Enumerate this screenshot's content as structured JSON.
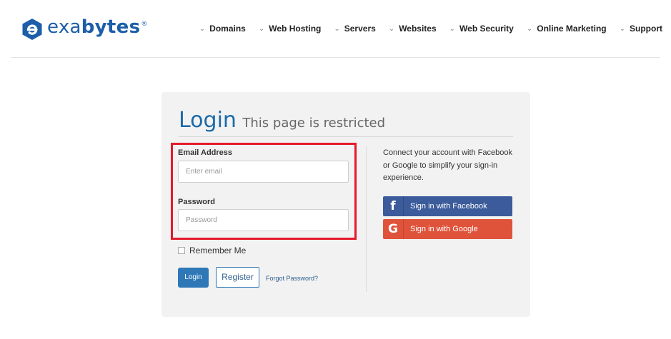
{
  "brand": {
    "name_light": "exa",
    "name_bold": "bytes",
    "registered": "®",
    "color": "#1c5ea8"
  },
  "nav": {
    "items": [
      {
        "label": "Domains"
      },
      {
        "label": "Web Hosting"
      },
      {
        "label": "Servers"
      },
      {
        "label": "Websites"
      },
      {
        "label": "Web Security"
      },
      {
        "label": "Online Marketing"
      },
      {
        "label": "Support"
      }
    ]
  },
  "login": {
    "title": "Login",
    "subtitle": "This page is restricted",
    "email_label": "Email Address",
    "email_placeholder": "Enter email",
    "password_label": "Password",
    "password_placeholder": "Password",
    "remember_label": "Remember Me",
    "login_button": "Login",
    "register_button": "Register",
    "forgot_link": "Forgot Password?",
    "highlight_color": "#e4192a"
  },
  "social": {
    "description": "Connect your account with Facebook or Google to simplify your sign-in experience.",
    "facebook": {
      "label": "Sign in with Facebook",
      "icon": "facebook-icon",
      "glyph": "f",
      "color": "#3b5b9a"
    },
    "google": {
      "label": "Sign in with Google",
      "icon": "google-icon",
      "glyph": "G",
      "color": "#e0533b"
    }
  }
}
